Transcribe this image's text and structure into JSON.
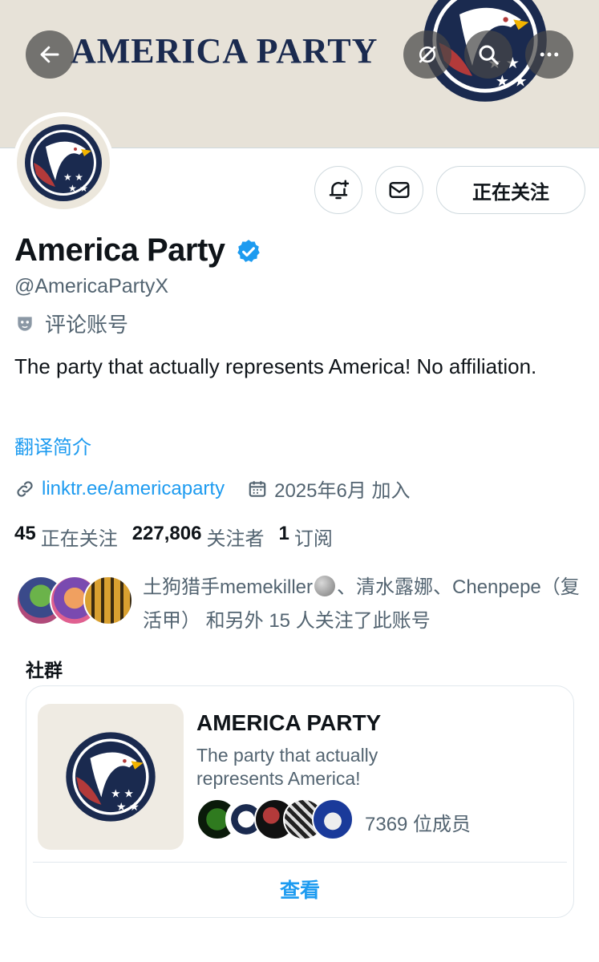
{
  "banner": {
    "text": "AMERICA PARTY"
  },
  "profile": {
    "name": "America Party",
    "handle": "@AmericaPartyX",
    "account_label": "评论账号",
    "bio": "The party that actually represents America! No affiliation.",
    "translate_bio": "翻译简介",
    "link": "linktr.ee/americaparty",
    "joined": "2025年6月 加入",
    "follow_button": "正在关注",
    "stats": {
      "following_count": "45",
      "following_label": "正在关注",
      "followers_count": "227,806",
      "followers_label": "关注者",
      "subscriptions_count": "1",
      "subscriptions_label": "订阅"
    },
    "known_followers": {
      "part1": "土狗猎手memekiller",
      "part2": "、清水露娜、Chenpepe（复活甲） 和另外 15 人关注了此账号"
    }
  },
  "community": {
    "section_title": "社群",
    "name": "AMERICA PARTY",
    "description": "The party that actually represents America!",
    "member_count": "7369 位成员",
    "view_button": "查看"
  },
  "colors": {
    "accent": "#1d9bf0",
    "text_primary": "#0f1419",
    "text_secondary": "#536471",
    "logo_navy": "#1a2a4f",
    "logo_red": "#b33a3a"
  },
  "icons": {
    "back": "back-arrow-icon",
    "grok": "grok-icon",
    "search": "search-icon",
    "more": "more-icon",
    "notify": "bell-plus-icon",
    "message": "envelope-icon",
    "verified": "verified-badge-icon",
    "label": "mask-icon",
    "link": "link-icon",
    "calendar": "calendar-icon"
  }
}
